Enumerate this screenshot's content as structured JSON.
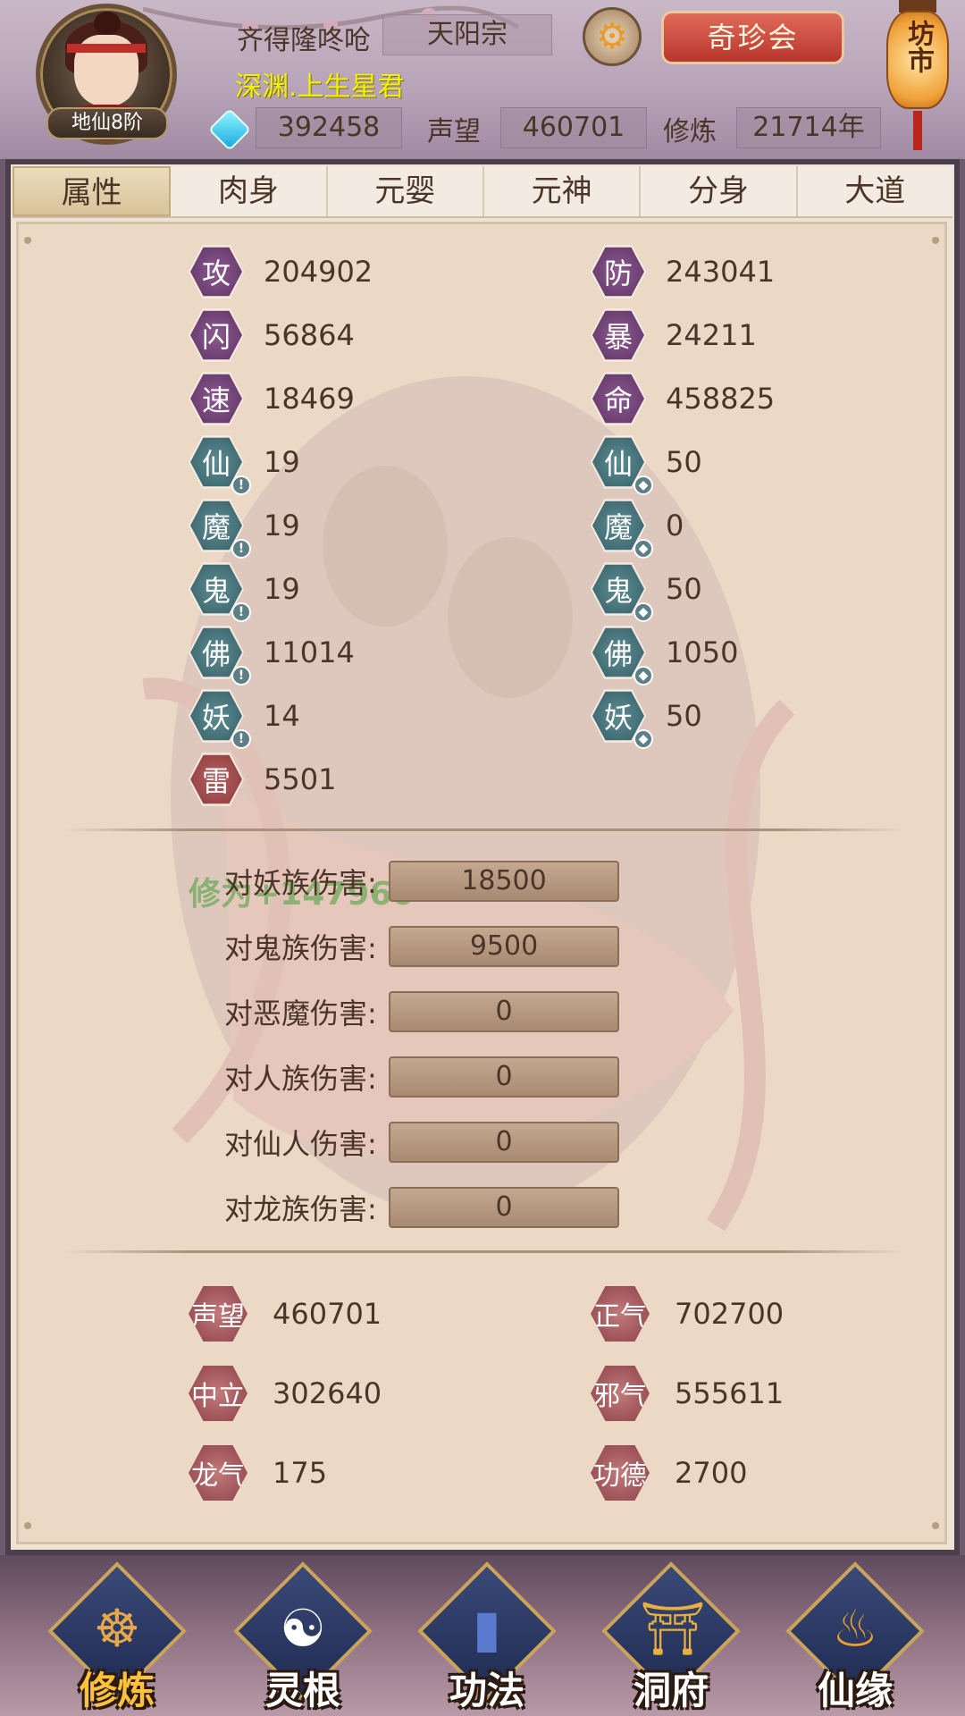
{
  "header": {
    "player_name": "齐得隆咚呛",
    "sect": "天阳宗",
    "title": "深渊.上生星君",
    "rank": "地仙8阶",
    "gems": "392458",
    "reputation_label": "声望",
    "reputation": "460701",
    "cultivation_label": "修炼",
    "cultivation": "21714年",
    "event_button": "奇珍会",
    "market_lantern": "坊市",
    "icons": {
      "settings": "gear-icon",
      "gem": "gem-icon"
    }
  },
  "tabs": [
    {
      "label": "属性",
      "active": true
    },
    {
      "label": "肉身",
      "active": false
    },
    {
      "label": "元婴",
      "active": false
    },
    {
      "label": "元神",
      "active": false
    },
    {
      "label": "分身",
      "active": false
    },
    {
      "label": "大道",
      "active": false
    }
  ],
  "stats": {
    "left": [
      {
        "icon": "攻",
        "value": "204902",
        "style": "purple"
      },
      {
        "icon": "闪",
        "value": "56864",
        "style": "purple"
      },
      {
        "icon": "速",
        "value": "18469",
        "style": "purple"
      },
      {
        "icon": "仙",
        "value": "19",
        "style": "teal",
        "badge": "!"
      },
      {
        "icon": "魔",
        "value": "19",
        "style": "teal",
        "badge": "!"
      },
      {
        "icon": "鬼",
        "value": "19",
        "style": "teal",
        "badge": "!"
      },
      {
        "icon": "佛",
        "value": "11014",
        "style": "teal",
        "badge": "!"
      },
      {
        "icon": "妖",
        "value": "14",
        "style": "teal",
        "badge": "!"
      },
      {
        "icon": "雷",
        "value": "5501",
        "style": "red"
      }
    ],
    "right": [
      {
        "icon": "防",
        "value": "243041",
        "style": "purple"
      },
      {
        "icon": "暴",
        "value": "24211",
        "style": "purple"
      },
      {
        "icon": "命",
        "value": "458825",
        "style": "purple"
      },
      {
        "icon": "仙",
        "value": "50",
        "style": "teal",
        "badge": "shield"
      },
      {
        "icon": "魔",
        "value": "0",
        "style": "teal",
        "badge": "shield"
      },
      {
        "icon": "鬼",
        "value": "50",
        "style": "teal",
        "badge": "shield"
      },
      {
        "icon": "佛",
        "value": "1050",
        "style": "teal",
        "badge": "shield"
      },
      {
        "icon": "妖",
        "value": "50",
        "style": "teal",
        "badge": "shield"
      }
    ]
  },
  "float_text": "修为+147960",
  "damage": [
    {
      "label": "对妖族伤害:",
      "value": "18500"
    },
    {
      "label": "对鬼族伤害:",
      "value": "9500"
    },
    {
      "label": "对恶魔伤害:",
      "value": "0"
    },
    {
      "label": "对人族伤害:",
      "value": "0"
    },
    {
      "label": "对仙人伤害:",
      "value": "0"
    },
    {
      "label": "对龙族伤害:",
      "value": "0"
    }
  ],
  "reputation": {
    "left": [
      {
        "icon": "声望",
        "value": "460701"
      },
      {
        "icon": "中立",
        "value": "302640"
      },
      {
        "icon": "龙气",
        "value": "175"
      }
    ],
    "right": [
      {
        "icon": "正气",
        "value": "702700"
      },
      {
        "icon": "邪气",
        "value": "555611"
      },
      {
        "icon": "功德",
        "value": "2700"
      }
    ]
  },
  "nav": [
    {
      "label": "修炼",
      "icon": "monk-icon",
      "active": true
    },
    {
      "label": "灵根",
      "icon": "yinyang-sword-icon",
      "active": false
    },
    {
      "label": "功法",
      "icon": "book-icon",
      "active": false
    },
    {
      "label": "洞府",
      "icon": "pagoda-icon",
      "active": false
    },
    {
      "label": "仙缘",
      "icon": "gourd-icon",
      "active": false
    }
  ],
  "colors": {
    "accent_red": "#b8362c",
    "title_yellow": "#f2f000",
    "active_nav": "#ffc23a"
  }
}
